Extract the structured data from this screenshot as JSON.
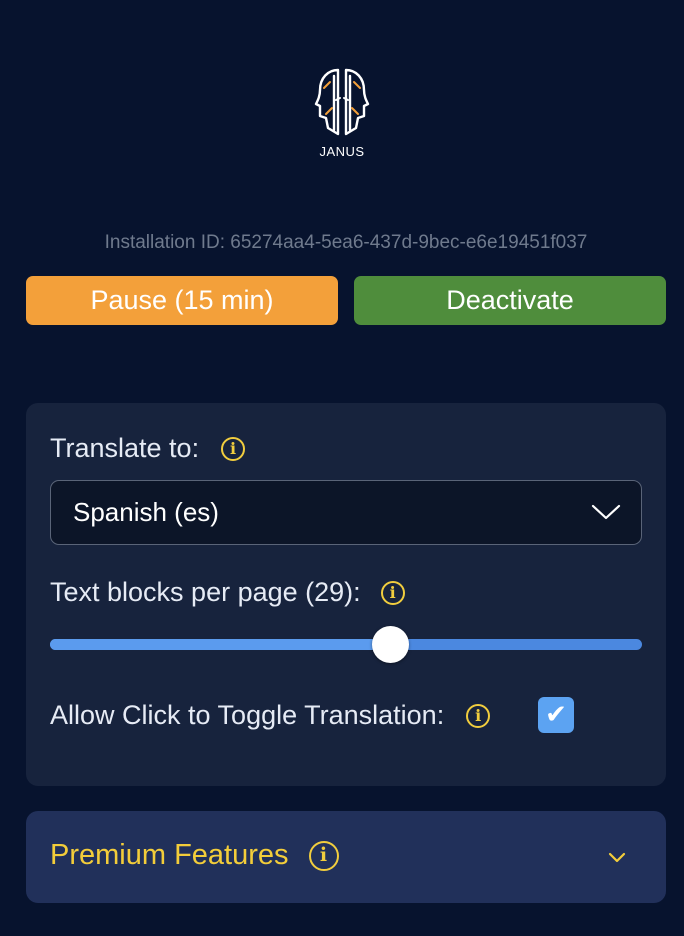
{
  "logo": {
    "text": "JANUS",
    "icon": "janus-face-icon"
  },
  "installation": {
    "text": "Installation ID: 65274aa4-5ea6-437d-9bec-e6e19451f037"
  },
  "buttons": {
    "pause_label": "Pause (15 min)",
    "deactivate_label": "Deactivate"
  },
  "settings": {
    "translate_label": "Translate to:",
    "language_selected": "Spanish (es)",
    "blocks_label": "Text blocks per page (29):",
    "blocks_value_fraction": 0.575,
    "toggle_label": "Allow Click to Toggle Translation:",
    "toggle_checked": true,
    "checkmark": "✔",
    "info_glyph": "i"
  },
  "premium": {
    "title": "Premium Features",
    "expanded": false
  },
  "colors": {
    "background": "#07132e",
    "pause": "#f3a03a",
    "deactivate": "#4f8d3c",
    "accent_yellow": "#f1cd3e",
    "slider": "#5b9bee",
    "checkbox": "#5ca3f2"
  }
}
